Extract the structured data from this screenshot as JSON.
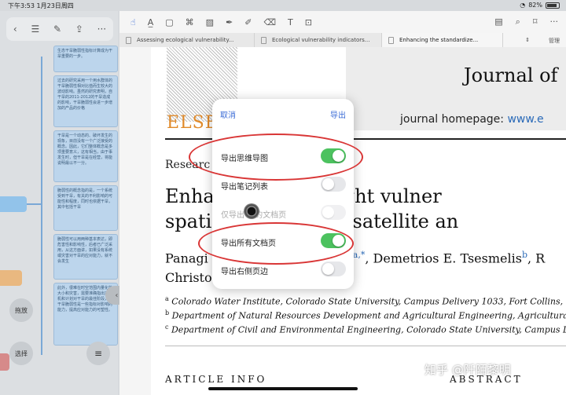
{
  "status": {
    "time": "下午3:53",
    "date": "1月23日周四",
    "battery": "82%"
  },
  "left_panel": {
    "toolbar_icons": [
      "back-icon",
      "list-icon",
      "edit-icon",
      "share-icon",
      "more-icon"
    ],
    "nodes": [
      "生态干旱脆弱性指标计算成为干旱重要的一步。",
      "过去的研究采用一个用水群体的干旱脆弱性相对比值而生较大的波动影响。虽然的研究表明，自干旱的2011-2012的干旱造成的影响，干旱脆弱性会进一步增加的产品的价格",
      "干旱是一个动态的、破坏发生的现象，目前没有一个广泛接受的概念。因此，它们整体概念是多项重要意义，这有相当，由于事发生时，但干旱是在经营，将能说明最以不一分。",
      "脆弱性的概念指的是，一个系统受到干旱，有关的不利影响的可能性和程度，同时也依据干旱，其中包括干旱",
      "脆弱性可以用两种基本表达，即危害性和影响性，后者已广泛采用，从这方面讲，如果没有系统或灾害对干旱的应对能力，就不会发生",
      "此外，很难在时空范围内量化的大小和灾害，需要准确指出对时机和计划对干旱的最佳阶段，以干旱脆弱性是一些指标对影响的能力，提高应对能力的可塑性。"
    ],
    "drag_label": "拖放",
    "select_label": "选择"
  },
  "toolbar": {
    "tools": [
      "hand-icon",
      "highlight-icon",
      "rectangle-icon",
      "lasso-icon",
      "pen-icon",
      "marker-icon",
      "eraser-icon",
      "textbox-icon",
      "image-icon"
    ],
    "right_tools": [
      "document-icon",
      "search-icon",
      "bookmark-icon",
      "more-icon"
    ]
  },
  "tabs": [
    {
      "label": "Assessing ecological vulnerability...",
      "active": false
    },
    {
      "label": "Ecological vulnerability indicators...",
      "active": false
    },
    {
      "label": "Enhancing the standardize...",
      "active": true
    }
  ],
  "tab_extra": {
    "manage": "管理"
  },
  "paper": {
    "journal_title": "Journal of",
    "homepage_label": "journal homepage: ",
    "homepage_link": "www.e",
    "publisher": "ELSE",
    "section": "Researc",
    "title_line1": "Enha                   ardized drought vulner",
    "title_line2": "spatio                  mation from satellite an",
    "authors_line1_a": "Panagi",
    "authors_line1_b": ", Demetrios E. Tsesmelis",
    "authors_line1_b_sup": "b",
    "authors_line1_c": ", R",
    "authors_line1_sup": "a,*",
    "authors_line2": "Christo",
    "affiliations": [
      {
        "sup": "a",
        "text": " Colorado Water Institute, Colorado State University, Campus Delivery 1033, Fort Collins, Color"
      },
      {
        "sup": "b",
        "text": " Department of Natural Resources Development and Agricultural Engineering, Agricultural Univer"
      },
      {
        "sup": "c",
        "text": " Department of Civil and Environmental Engineering, Colorado State University, Campus Delivery"
      }
    ],
    "article_info": "ARTICLE INFO",
    "abstract": "ABSTRACT"
  },
  "modal": {
    "cancel": "取消",
    "export": "导出",
    "options": [
      {
        "label": "导出思维导图",
        "on": true,
        "disabled": false
      },
      {
        "label": "导出笔记列表",
        "on": false,
        "disabled": false
      },
      {
        "label": "仅导出        过的文档页",
        "on": false,
        "disabled": true
      },
      {
        "label": "导出所有文档页",
        "on": true,
        "disabled": false
      },
      {
        "label": "导出右侧页边",
        "on": false,
        "disabled": false
      }
    ]
  },
  "watermark": "知乎 @阡陌黎明",
  "colors": {
    "accent": "#3a6bd6",
    "toggle_on": "#4cc25f",
    "annotation": "#d93636",
    "publisher": "#e08a2a"
  }
}
